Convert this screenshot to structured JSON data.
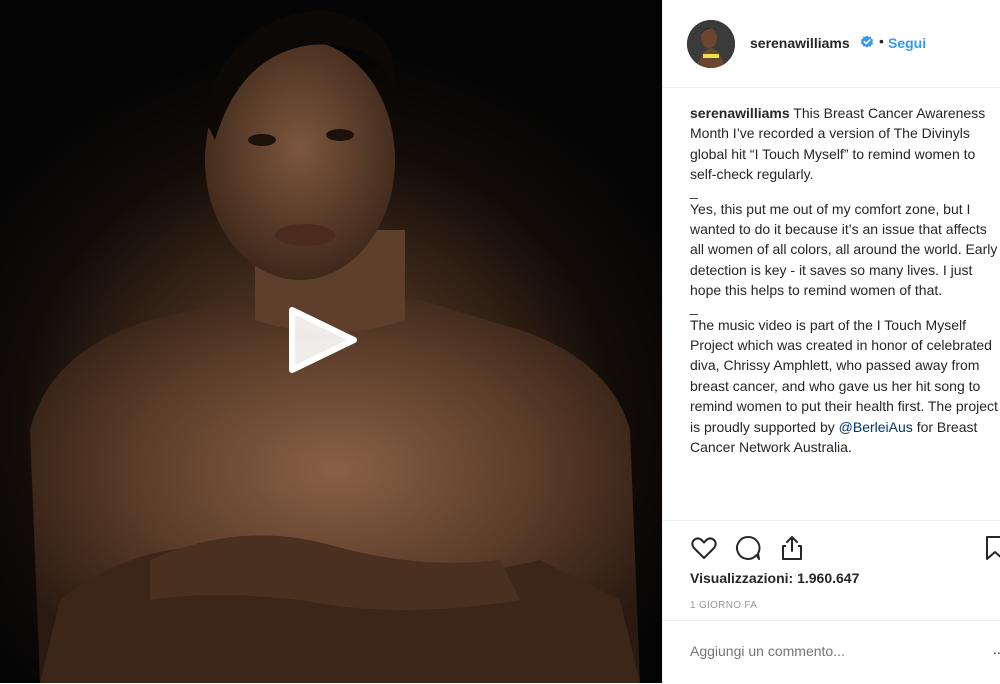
{
  "post": {
    "username": "serenawilliams",
    "separator": "•",
    "follow_label": "Segui",
    "caption": {
      "lead": "This Breast Cancer Awareness Month I’ve recorded a version of The Divinyls global hit “I Touch Myself” to remind women to self-check regularly.",
      "dash1": "_",
      "para2": "Yes, this put me out of my comfort zone, but I wanted to do it because it’s an issue that affects all women of all colors, all around the world. Early detection is key - it saves so many lives. I just hope this helps to remind women of that.",
      "dash2": "_",
      "para3_before": "The music video is part of the I Touch Myself Project which was created in honor of celebrated diva, Chrissy Amphlett, who passed away from breast cancer, and who gave us her hit song to remind women to put their health first. The project is proudly supported by",
      "mention": "@BerleiAus",
      "para3_after": "for Breast Cancer Network Australia."
    },
    "views": "Visualizzazioni: 1.960.647",
    "timestamp": "1 GIORNO FA",
    "comment_placeholder": "Aggiungi un commento...",
    "more": "..."
  },
  "icons": {
    "like": "heart-icon",
    "comment": "comment-icon",
    "share": "share-icon",
    "save": "bookmark-icon",
    "verified": "verified-badge-icon",
    "play": "play-icon"
  },
  "colors": {
    "link": "#3897f0",
    "mention": "#003569",
    "text": "#262626",
    "muted": "#999999",
    "border": "#efefef"
  }
}
